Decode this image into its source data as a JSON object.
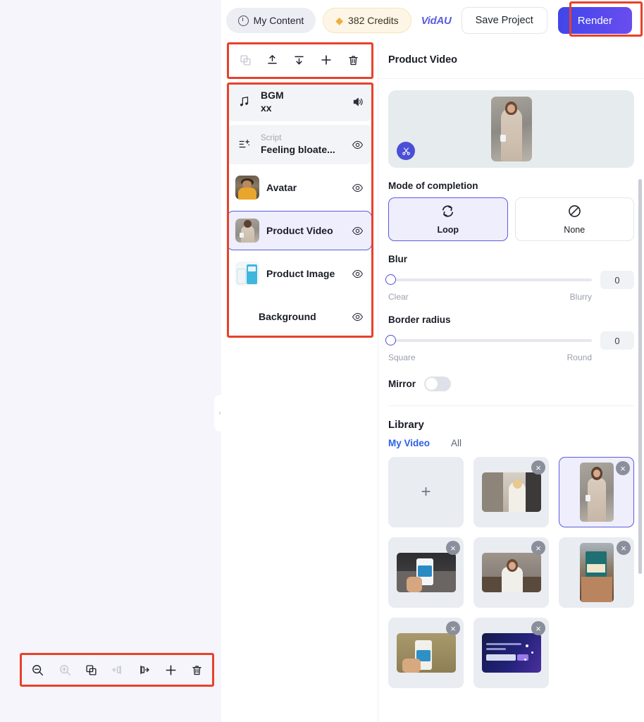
{
  "topbar": {
    "my_content": "My Content",
    "credits": "382 Credits",
    "brand": "VidAU",
    "save_project": "Save Project",
    "render": "Render",
    "clock_icon": "clock-icon",
    "diamond_icon": "diamond-icon"
  },
  "layer_toolbar": {
    "items": [
      {
        "name": "duplicate-icon",
        "glyph": "duplicate",
        "disabled": true
      },
      {
        "name": "bring-to-front-icon",
        "glyph": "up",
        "disabled": false
      },
      {
        "name": "send-to-back-icon",
        "glyph": "down",
        "disabled": false
      },
      {
        "name": "add-icon",
        "glyph": "plus",
        "disabled": false
      },
      {
        "name": "delete-icon",
        "glyph": "trash",
        "disabled": false
      }
    ]
  },
  "layers": [
    {
      "title": "BGM",
      "sub": "",
      "second": "xx",
      "action": "volume-icon",
      "state": "muted",
      "thumb": "none",
      "icon": "music-icon"
    },
    {
      "title": "Feeling bloate...",
      "sub": "Script",
      "second": "",
      "action": "eye-icon",
      "state": "muted",
      "thumb": "none",
      "icon": "script-icon"
    },
    {
      "title": "Avatar",
      "sub": "",
      "second": "",
      "action": "eye-icon",
      "state": "normal",
      "thumb": "avatar",
      "icon": ""
    },
    {
      "title": "Product Video",
      "sub": "",
      "second": "",
      "action": "eye-icon",
      "state": "selected",
      "thumb": "product-video",
      "icon": ""
    },
    {
      "title": "Product Image",
      "sub": "",
      "second": "",
      "action": "eye-icon",
      "state": "normal",
      "thumb": "product-image",
      "icon": ""
    },
    {
      "title": "Background",
      "sub": "",
      "second": "",
      "action": "eye-icon",
      "state": "normal",
      "thumb": "none",
      "icon": ""
    }
  ],
  "bottom_toolbar": {
    "items": [
      {
        "name": "zoom-out-icon",
        "disabled": false
      },
      {
        "name": "zoom-in-icon",
        "disabled": true
      },
      {
        "name": "duplicate-icon",
        "disabled": false
      },
      {
        "name": "split-left-icon",
        "disabled": true
      },
      {
        "name": "split-right-icon",
        "disabled": false
      },
      {
        "name": "add-icon",
        "disabled": false
      },
      {
        "name": "delete-icon",
        "disabled": false
      }
    ]
  },
  "properties": {
    "title": "Product Video",
    "trim_icon": "scissors-icon",
    "mode_label": "Mode of completion",
    "modes": [
      {
        "label": "Loop",
        "icon": "loop-icon",
        "active": true
      },
      {
        "label": "None",
        "icon": "none-icon",
        "active": false
      }
    ],
    "blur": {
      "label": "Blur",
      "value": "0",
      "min_label": "Clear",
      "max_label": "Blurry",
      "percent": 0
    },
    "border_radius": {
      "label": "Border radius",
      "value": "0",
      "min_label": "Square",
      "max_label": "Round",
      "percent": 0
    },
    "mirror": {
      "label": "Mirror",
      "on": false
    },
    "library": {
      "title": "Library",
      "tabs": [
        {
          "label": "My Video",
          "active": true
        },
        {
          "label": "All",
          "active": false
        }
      ],
      "add_glyph": "+",
      "close_glyph": "×",
      "items": [
        {
          "kind": "add",
          "art": "",
          "selected": false
        },
        {
          "kind": "video",
          "art": "kitchen-woman",
          "orient": "land",
          "selected": false
        },
        {
          "kind": "video",
          "art": "dress-woman",
          "orient": "port",
          "selected": true
        },
        {
          "kind": "video",
          "art": "hand-bottle",
          "orient": "land",
          "selected": false
        },
        {
          "kind": "video",
          "art": "talking-woman",
          "orient": "land",
          "selected": false
        },
        {
          "kind": "video",
          "art": "prebiotic-box",
          "orient": "port",
          "selected": false
        },
        {
          "kind": "video",
          "art": "grass-bottle",
          "orient": "land",
          "selected": false
        },
        {
          "kind": "video",
          "art": "dark-ad",
          "orient": "land",
          "selected": false
        }
      ]
    }
  },
  "canvas": {
    "collapse_glyph": "›"
  }
}
